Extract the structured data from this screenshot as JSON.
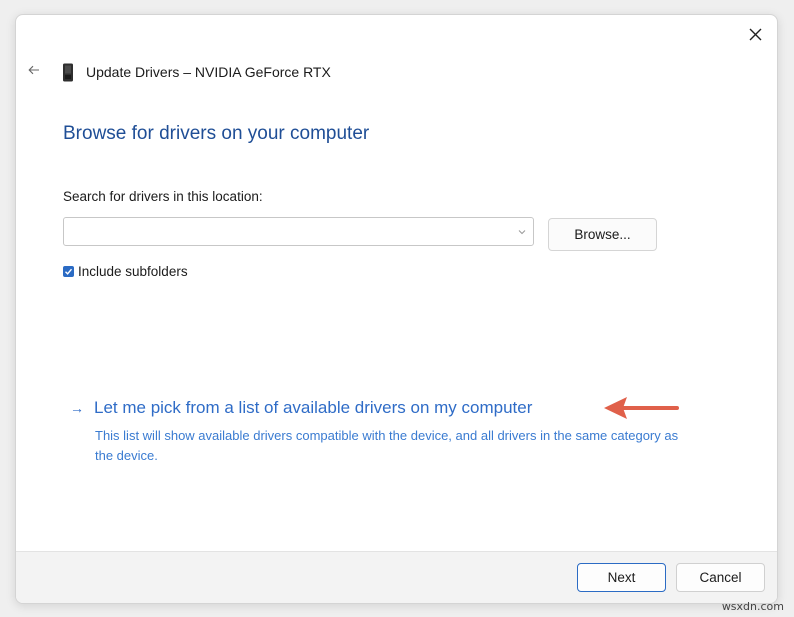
{
  "window": {
    "title": "Update Drivers – NVIDIA GeForce RTX",
    "close_icon": "close-icon",
    "back_icon": "back-arrow-icon"
  },
  "main": {
    "heading": "Browse for drivers on your computer",
    "search_label": "Search for drivers in this location:",
    "path_value": "",
    "browse_label": "Browse...",
    "include_subfolders_label": "Include subfolders",
    "include_subfolders_checked": true,
    "pick_link_label": "Let me pick from a list of available drivers on my computer",
    "pick_link_description": "This list will show available drivers compatible with the device, and all drivers in the same category as the device."
  },
  "footer": {
    "next_label": "Next",
    "cancel_label": "Cancel"
  },
  "watermark": "wsxdn.com",
  "colors": {
    "heading": "#1f4e96",
    "link": "#2f6cc7",
    "accent": "#2b6bc4",
    "annotation_arrow": "#e0604a"
  }
}
